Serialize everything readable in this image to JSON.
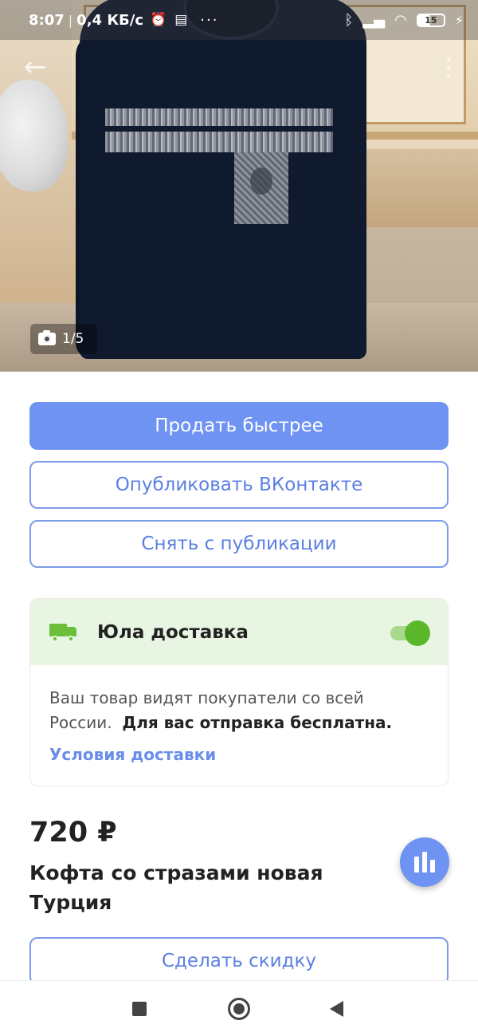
{
  "status_bar": {
    "time": "8:07",
    "separator": "|",
    "speed": "0,4 КБ/с",
    "dots": "···",
    "battery": "15"
  },
  "photo": {
    "counter": "1/5",
    "icons": [
      "back-arrow-icon",
      "more-vertical-icon",
      "camera-icon"
    ]
  },
  "actions": {
    "sell_faster": "Продать быстрее",
    "publish_vk": "Опубликовать ВКонтакте",
    "unpublish": "Снять с публикации",
    "discount": "Сделать скидку"
  },
  "delivery": {
    "title": "Юла доставка",
    "enabled": true,
    "text": "Ваш товар видят покупатели со всей России.",
    "text_bold": "Для вас отправка бесплатна.",
    "link": "Условия доставки",
    "accent_color": "#5cb82b"
  },
  "listing": {
    "price": "720 ₽",
    "title": "Кофта со стразами новая Турция"
  },
  "colors": {
    "primary": "#6e93f3",
    "outline": "#7c9be9",
    "link": "#6a8de9",
    "delivery_bg": "#e9f5e3"
  }
}
